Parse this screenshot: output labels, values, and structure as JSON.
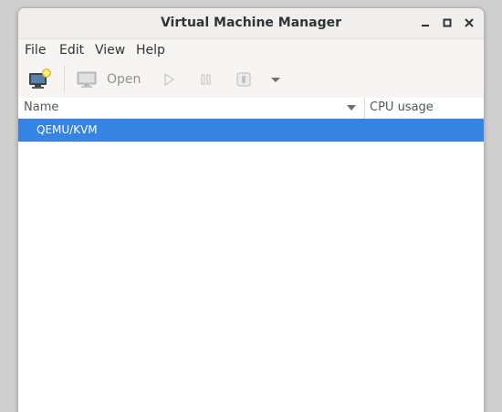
{
  "window": {
    "title": "Virtual Machine Manager"
  },
  "menubar": {
    "items": [
      "File",
      "Edit",
      "View",
      "Help"
    ]
  },
  "toolbar": {
    "new_vm_icon": "new-vm-icon",
    "open_label": "Open",
    "run_icon": "play-icon",
    "pause_icon": "pause-icon",
    "shutdown_icon": "shutdown-icon",
    "dropdown_icon": "chevron-down-icon"
  },
  "list": {
    "columns": [
      "Name",
      "CPU usage"
    ],
    "rows": [
      {
        "name": "QEMU/KVM",
        "selected": true
      }
    ]
  },
  "colors": {
    "selection": "#3584e4",
    "titlebar": "#f0efee"
  }
}
